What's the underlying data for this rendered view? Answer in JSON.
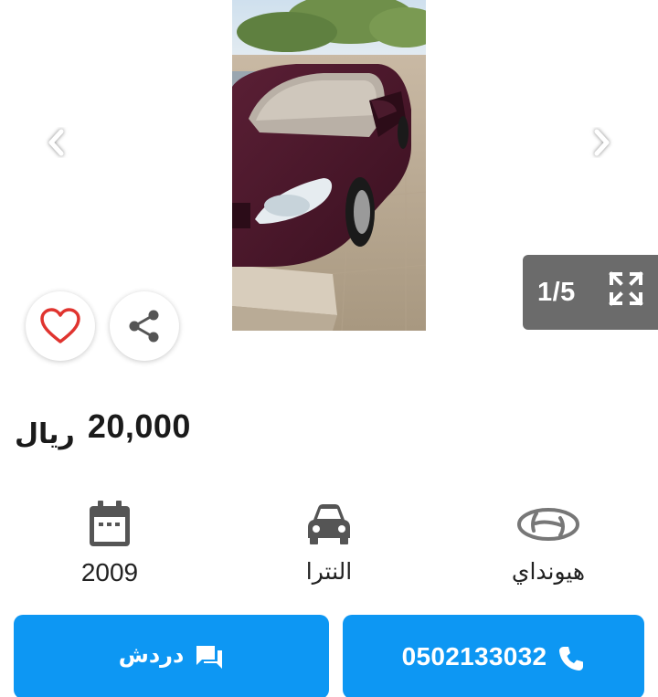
{
  "gallery": {
    "counter": "1/5",
    "photo_alt": "car-photo"
  },
  "listing": {
    "price_value": "20,000",
    "price_currency": "ريال"
  },
  "specs": {
    "year": "2009",
    "model": "النترا",
    "make": "هيونداي"
  },
  "actions": {
    "chat_label": "دردش",
    "phone_number": "0502133032"
  },
  "colors": {
    "primary": "#0d97f3",
    "counter_bg": "#6b6b6b",
    "favorite": "#e0342f",
    "icon_gray": "#555555"
  }
}
